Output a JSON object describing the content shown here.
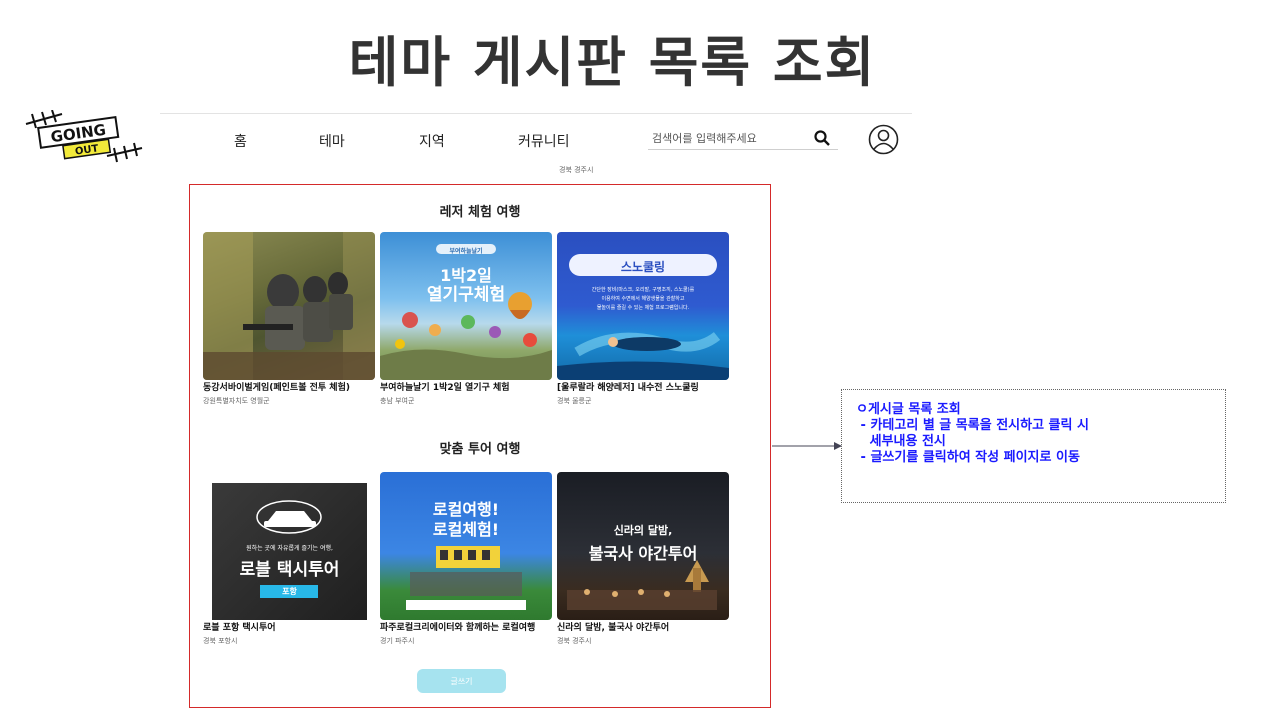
{
  "slide_title": "테마 게시판 목록 조회",
  "logo": {
    "line1": "GOING",
    "line2": "OUT"
  },
  "nav": {
    "home": "홈",
    "theme": "테마",
    "region": "지역",
    "community": "커뮤니티"
  },
  "search": {
    "placeholder": "검색어를 입력해주세요"
  },
  "location_tag": "경북 경주시",
  "sections": [
    {
      "title": "레저 체험 여행",
      "cards": [
        {
          "title": "동강서바이벌게임(페인트볼 전투 체험)",
          "location": "강원특별자치도 영월군"
        },
        {
          "title": "부여하늘날기 1박2일 열기구 체험",
          "location": "충남 부여군",
          "thumb": {
            "caption": "부여하늘날기",
            "headline1": "1박2일",
            "headline2": "열기구체험"
          }
        },
        {
          "title": "[울루랄라 해양레저] 내수전 스노쿨링",
          "location": "경북 울릉군",
          "thumb": {
            "banner": "스노쿨링",
            "desc1": "간단한 장비(마스크, 오리발, 구명조끼, 스노쿨)를",
            "desc2": "이용하여 수면에서 해양생물을 관찰하고",
            "desc3": "물놀이를 즐길 수 있는 체험 프로그램입니다."
          }
        }
      ]
    },
    {
      "title": "맞춤 투어 여행",
      "cards": [
        {
          "title": "로블 포항 택시투어",
          "location": "경북 포항시",
          "thumb": {
            "sub": "원하는 곳에 자유롭게 즐기는 여행,",
            "headline": "로블 택시투어",
            "tag": "포항"
          }
        },
        {
          "title": "파주로컬크리에이터와 함께하는 로컬여행",
          "location": "경기 파주시",
          "thumb": {
            "headline1": "로컬여행!",
            "headline2": "로컬체험!"
          }
        },
        {
          "title": "신라의 달밤, 불국사 야간투어",
          "location": "경북 경주시",
          "thumb": {
            "headline1": "신라의 달밤,",
            "headline2": "불국사 야간투어"
          }
        }
      ]
    }
  ],
  "write_button": "글쓰기",
  "annotation": {
    "lines": [
      "ㅇ게시글 목록 조회",
      " - 카테고리 별 글 목록을 전시하고 클릭 시",
      "   세부내용 전시",
      " - 글쓰기를 클릭하여 작성 페이지로 이동"
    ]
  },
  "colors": {
    "frame": "#d42a2a",
    "annotation_text": "#1a1aff",
    "write_button": "#a6e3ef"
  }
}
